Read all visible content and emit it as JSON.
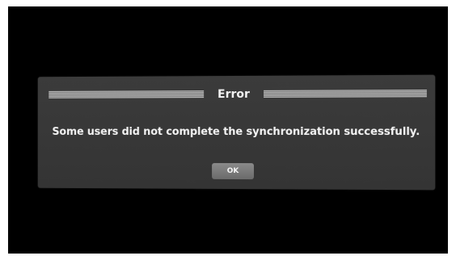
{
  "dialog": {
    "title": "Error",
    "message": "Some users did not complete the synchronization successfully.",
    "ok_label": "OK"
  },
  "colors": {
    "background": "#000000",
    "dialog": "#383838",
    "text": "#f2f2f2",
    "button": "#7a7a7a"
  }
}
